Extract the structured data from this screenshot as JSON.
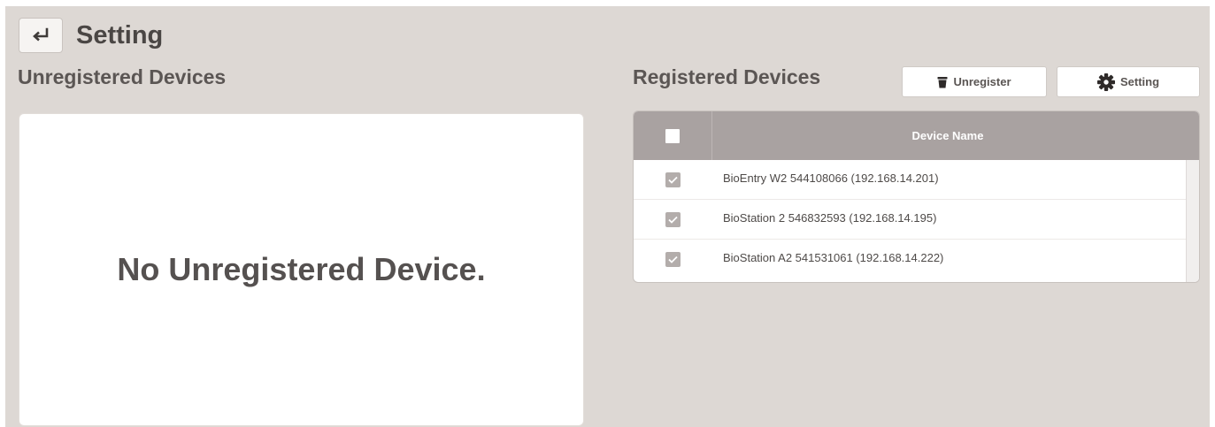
{
  "page": {
    "title": "Setting"
  },
  "unregistered": {
    "title": "Unregistered Devices",
    "empty_message": "No Unregistered Device."
  },
  "registered": {
    "title": "Registered Devices",
    "unregister_label": "Unregister",
    "setting_label": "Setting",
    "column_header": "Device Name",
    "rows": [
      {
        "name": "BioEntry W2 544108066 (192.168.14.201)",
        "checked": true
      },
      {
        "name": "BioStation 2 546832593 (192.168.14.195)",
        "checked": true
      },
      {
        "name": "BioStation A2 541531061 (192.168.14.222)",
        "checked": true
      }
    ]
  },
  "icons": {
    "back": "return-arrow-icon",
    "unregister": "trash-icon",
    "setting": "gear-icon"
  },
  "colors": {
    "background": "#ddd8d4",
    "table_header": "#a9a2a1",
    "checkbox_checked": "#b3adab"
  }
}
